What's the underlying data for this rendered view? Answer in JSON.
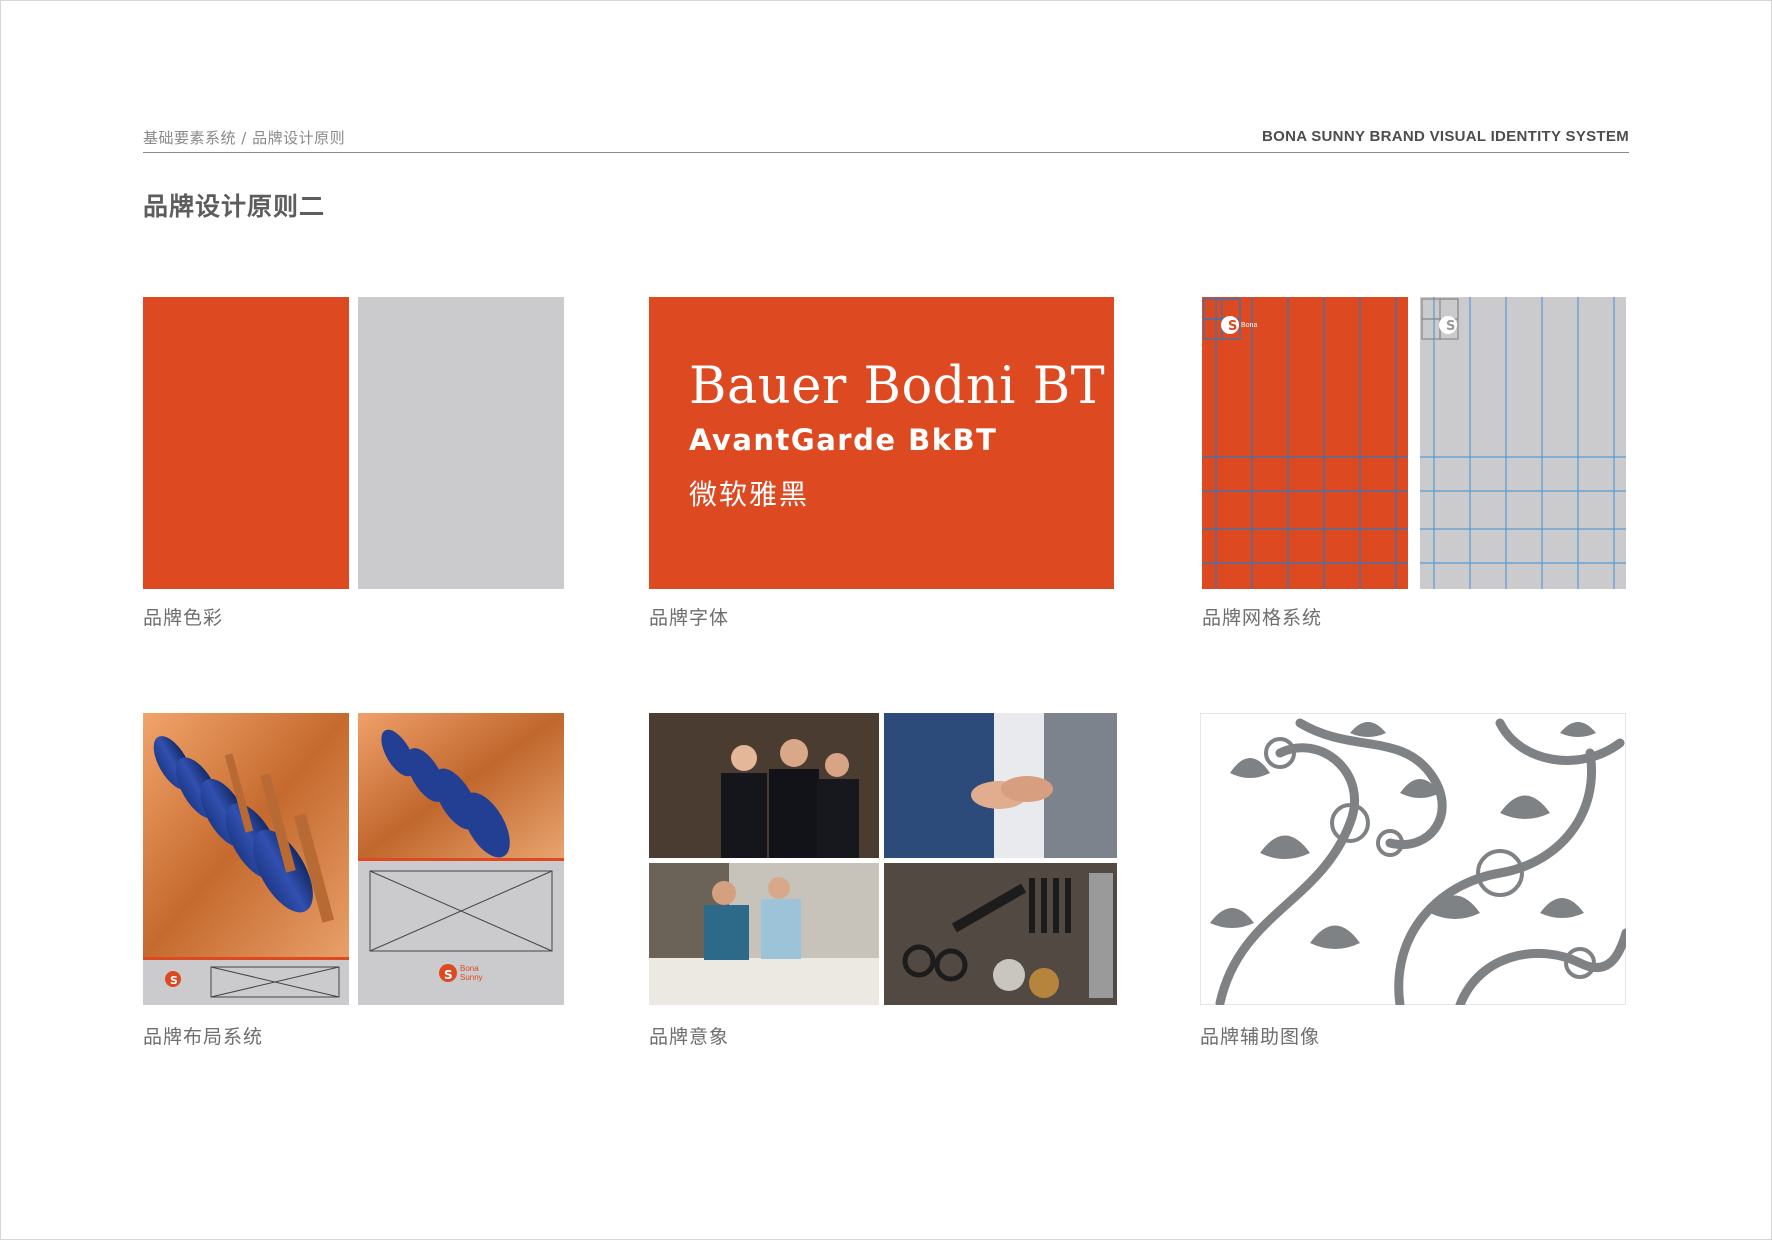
{
  "header": {
    "breadcrumb": "基础要素系统 / 品牌设计原则",
    "brand_line": "BONA SUNNY BRAND VISUAL IDENTITY SYSTEM",
    "page_title": "品牌设计原则二"
  },
  "colors": {
    "brand_orange": "#dd4a22",
    "brand_grey": "#cbcbcd",
    "grid_line": "#5a9bd5",
    "pattern_grey": "#7f8285"
  },
  "fonts_card": {
    "font1": "Bauer Bodni BT",
    "font2": "AvantGarde BkBT",
    "font3": "微软雅黑"
  },
  "logo": {
    "line1": "Bona",
    "line2": "Sunny"
  },
  "captions": {
    "color": "品牌色彩",
    "typeface": "品牌字体",
    "grid": "品牌网格系统",
    "layout": "品牌布局系统",
    "imagery": "品牌意象",
    "pattern": "品牌辅助图像"
  }
}
